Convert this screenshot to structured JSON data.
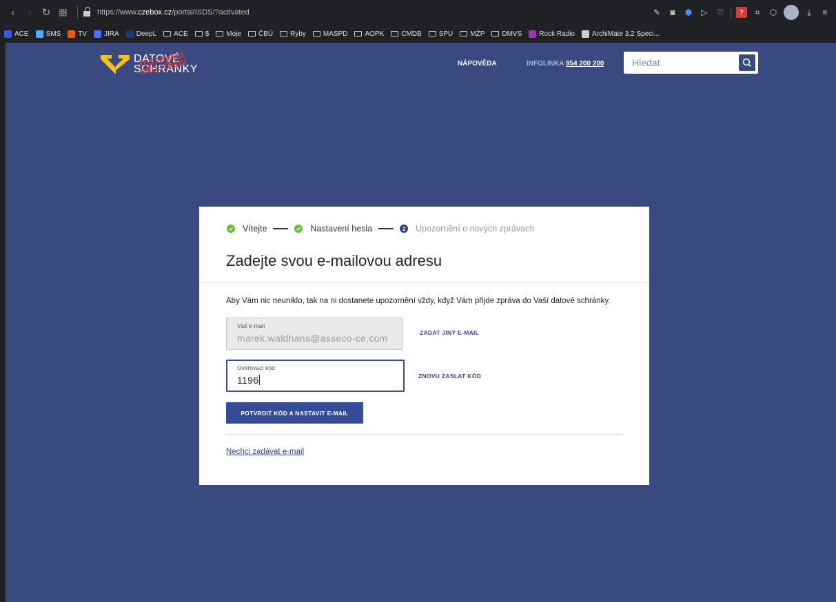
{
  "browser": {
    "url_prefix": "https://www.",
    "url_domain": "czebox.cz",
    "url_path": "/portal/ISDS/?activated",
    "bookmarks": [
      "ACE",
      "SMS",
      "TV",
      "JIRA",
      "DeepL",
      "ACE",
      "$",
      "Moje",
      "ČBÚ",
      "Ryby",
      "MASPD",
      "AOPK",
      "CMDB",
      "SPU",
      "MŽP",
      "DMVS",
      "Rock Radio",
      "ArchiMate 3.2 Speci..."
    ],
    "ext_badge": "7"
  },
  "header": {
    "logo_line1": "DATOVÉ",
    "logo_line2": "SCHRÁNKY",
    "logo_stamp1": "TESTOVACÍ",
    "logo_stamp2": "PROSTŘEDÍ",
    "help_label": "NÁPOVĚDA",
    "infoline_label": "INFOLINKA",
    "infoline_number": "954 200 200",
    "search_placeholder": "Hledat"
  },
  "card": {
    "steps": [
      {
        "label": "Vítejte",
        "state": "done"
      },
      {
        "label": "Nastavení hesla",
        "state": "done"
      },
      {
        "label": "Upozornění o nových zprávach",
        "state": "current",
        "number": "2"
      }
    ],
    "title": "Zadejte svou e-mailovou adresu",
    "intro": "Aby Vám nic neuniklo, tak na ni dostanete upozornění vždy, když Vám přijde zpráva do Vaší datové schránky.",
    "email_label": "Váš e-mail",
    "email_value": "marek.waldhans@asseco-ce.com",
    "change_email": "ZADAT JINÝ E-MAIL",
    "code_label": "Ověřovací kód",
    "code_value": "1196",
    "resend_code": "ZNOVU ZASLAT KÓD",
    "confirm_button": "POTVRDIT KÓD A NASTAVIT E-MAIL",
    "skip_link": "Nechci zadávat e-mail"
  },
  "colors": {
    "page_bg": "#3a4a80",
    "primary": "#354d97",
    "check": "#6cb93c",
    "logo_yellow": "#f2c21a",
    "stamp_red": "#e53935"
  }
}
